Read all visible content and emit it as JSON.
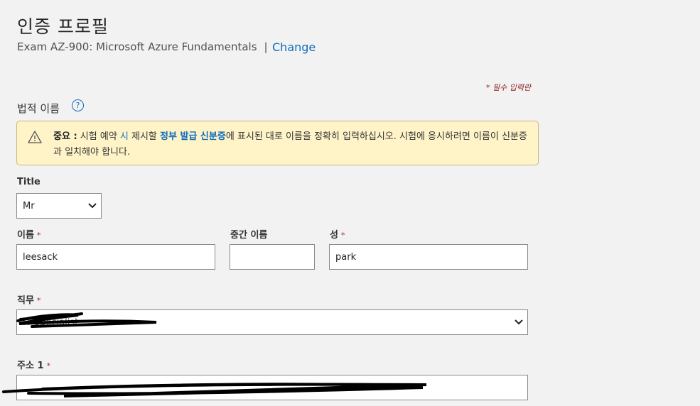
{
  "page": {
    "title": "인증 프로필",
    "exam": "Exam AZ-900: Microsoft Azure Fundamentals",
    "separator": "|",
    "change_link": "Change",
    "required_note": "* 필수 입력란"
  },
  "legal_name": {
    "label": "법적 이름",
    "help_icon": "?"
  },
  "notice": {
    "strong": "중요 :",
    "text_1": " 시험 예약 ",
    "link_1": "시",
    "text_2": " 제시할 ",
    "link_2": "정부 발급 신분증",
    "text_3": "에 표시된 대로 이름을 정확히 입력하십시오. 시험에 응시하려면 이름이 신분증과 일치해야 합니다."
  },
  "form": {
    "title_label": "Title",
    "title_value": "Mr",
    "first_name_label": "이름",
    "first_name_value": "leesack",
    "middle_name_label": "중간 이름",
    "middle_name_value": "",
    "last_name_label": "성",
    "last_name_value": "park",
    "job_label": "직무",
    "job_value": "IT Specialist",
    "address_label": "주소 1",
    "address_value": "",
    "required_mark": "*"
  },
  "colors": {
    "link": "#0f6cbd",
    "notice_bg": "#fff3c8",
    "required": "#a4262c"
  }
}
